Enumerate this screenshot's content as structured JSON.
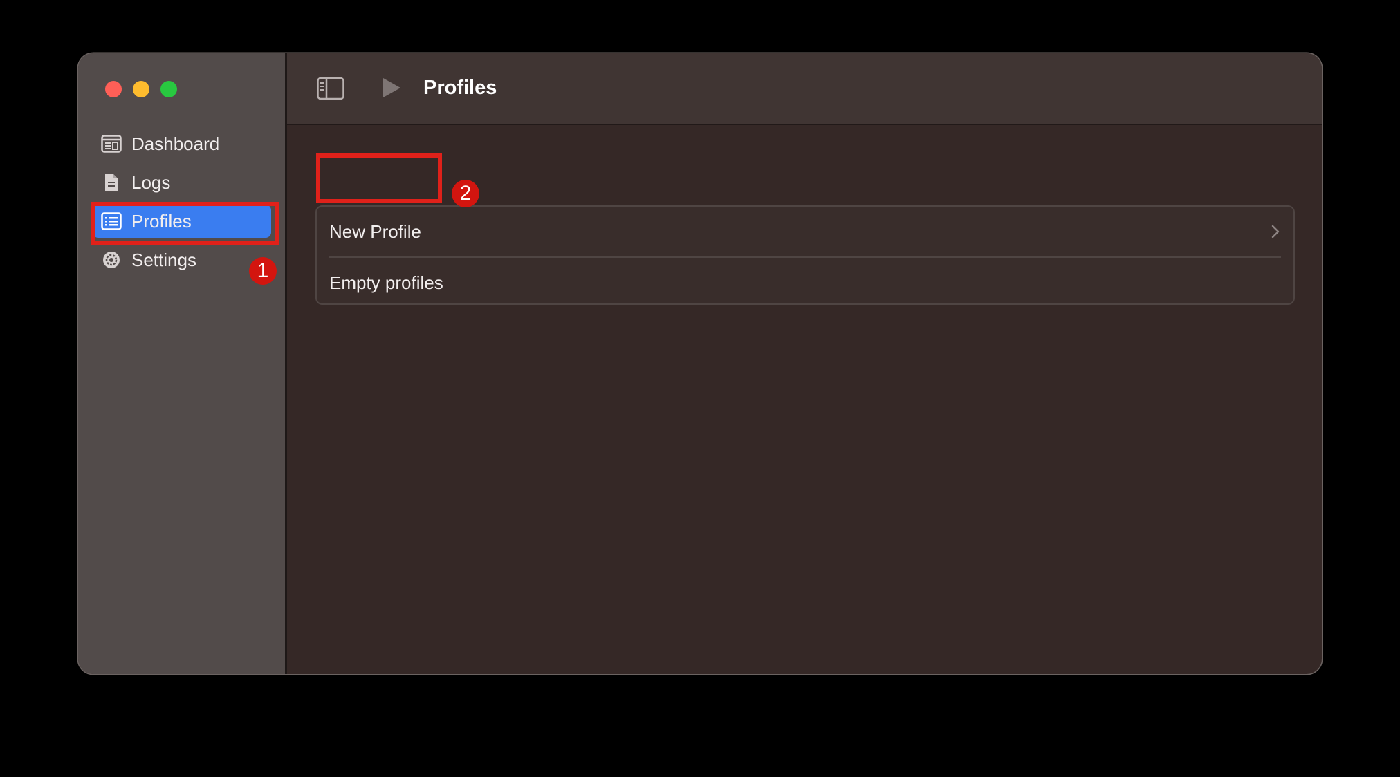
{
  "toolbar": {
    "title": "Profiles"
  },
  "sidebar": {
    "items": [
      {
        "label": "Dashboard",
        "icon": "dashboard-icon"
      },
      {
        "label": "Logs",
        "icon": "document-icon"
      },
      {
        "label": "Profiles",
        "icon": "list-icon",
        "active": true
      },
      {
        "label": "Settings",
        "icon": "gear-icon"
      }
    ]
  },
  "profiles": {
    "new_profile_label": "New Profile",
    "empty_label": "Empty profiles"
  },
  "annotations": {
    "badge_1": "1",
    "badge_2": "2"
  },
  "colors": {
    "accent": "#3a7df0",
    "highlight": "#e0211a",
    "sidebar_bg": "#524b4a",
    "content_bg": "#352826"
  }
}
